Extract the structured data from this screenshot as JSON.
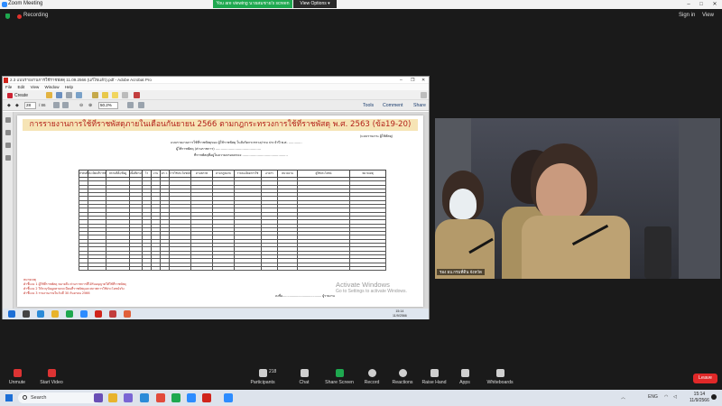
{
  "zoom": {
    "app_title": "Zoom Meeting",
    "share_banner": "You are viewing นายสมชาย's screen",
    "view_options": "View Options",
    "recording": "Recording",
    "sign_in": "Sign in",
    "view": "View",
    "controls": [
      {
        "label": "Unmute",
        "icon": "microphone-muted-icon"
      },
      {
        "label": "Start Video",
        "icon": "video-off-icon"
      },
      {
        "label": "Participants",
        "icon": "participants-icon",
        "count": "218"
      },
      {
        "label": "Chat",
        "icon": "chat-icon"
      },
      {
        "label": "Share Screen",
        "icon": "share-screen-icon"
      },
      {
        "label": "Record",
        "icon": "record-icon"
      },
      {
        "label": "Reactions",
        "icon": "reactions-icon"
      },
      {
        "label": "Raise Hand",
        "icon": "raise-hand-icon"
      },
      {
        "label": "Apps",
        "icon": "apps-icon"
      },
      {
        "label": "Whiteboards",
        "icon": "whiteboard-icon"
      }
    ],
    "leave": "Leave",
    "video_name": "รอง ผบ.กรมที่ดิน จังหวัด"
  },
  "acrobat": {
    "window_title": "2.3 แบบรายงานการใช้ราชพัสดุ 11.09.2566 (แก้ไขแล้ว).pdf - Adobe Acrobat Pro",
    "menu": [
      "File",
      "Edit",
      "View",
      "Window",
      "Help"
    ],
    "create_label": "Create",
    "page_current": "28",
    "page_total": "/ 86",
    "zoom_level": "50.2%",
    "tabs": [
      "Tools",
      "Comment",
      "Share"
    ]
  },
  "document": {
    "title": "การรายงานการใช้ที่ราชพัสดุภายในเดือนกันยายน 2566 ตามกฎกระทรวงการใช้ที่ราชพัสดุ พ.ศ. 2563 (ข้อ19-20)",
    "top_right": "(แบบรายงาน ผู้ใช้พัสดุ)",
    "line1": "แบบรายงานการใช้ที่ราชพัสดุของ ผู้ใช้ราชพัสดุ ในสังกัดกระทรวง/กรม ประจำปี พ.ศ. .............",
    "line2": "ผู้ใช้ราชพัสดุ (ส่วนราชการ) ............................................",
    "line3": "ที่ราชพัสดุที่อยู่ในความครอบครอง ............................................",
    "table_headers": [
      "ลำดับที่",
      "ทะเบียนที่ราชพัสดุ",
      "สถานที่ตั้ง/ที่อยู่",
      "เนื้อที่ตามทะเบียน",
      "ไร่",
      "งาน",
      "ตร.ว.",
      "การใช้ประโยชน์ปัจจุบัน",
      "ตามสภาพ",
      "ตามกฎหมาย",
      "รายละเอียดการใช้",
      "อาคาร",
      "หน่วยงาน",
      "ผู้ใช้ประโยชน์",
      "หมายเหตุ"
    ],
    "notes": [
      "หมายเหตุ",
      "คำชี้แจง 1  ผู้ใช้ที่ราชพัสดุ หมายถึง ส่วนราชการที่ได้รับอนุญาตให้ใช้ที่ราชพัสดุ",
      "คำชี้แจง 2  ให้ระบุข้อมูลตามทะเบียนที่ราชพัสดุและสภาพการใช้ประโยชน์จริง",
      "คำชี้แจง 3  รายงานภายในวันที่ 30 กันยายน 2566"
    ],
    "signature": "ลงชื่อ........................................ ผู้รายงาน"
  },
  "windows_notice": {
    "title": "Activate Windows",
    "subtitle": "Go to Settings to activate Windows."
  },
  "inner_taskbar": {
    "time": "15:14",
    "date": "11/9/2566"
  },
  "taskbar": {
    "search_placeholder": "Search",
    "lang": "ENG",
    "time": "15:14",
    "date": "11/9/2566"
  },
  "colors": {
    "zoom_green": "#1ea84f",
    "leave_red": "#e02828",
    "title_red": "#b3221a",
    "title_band": "#f6e4b5"
  }
}
